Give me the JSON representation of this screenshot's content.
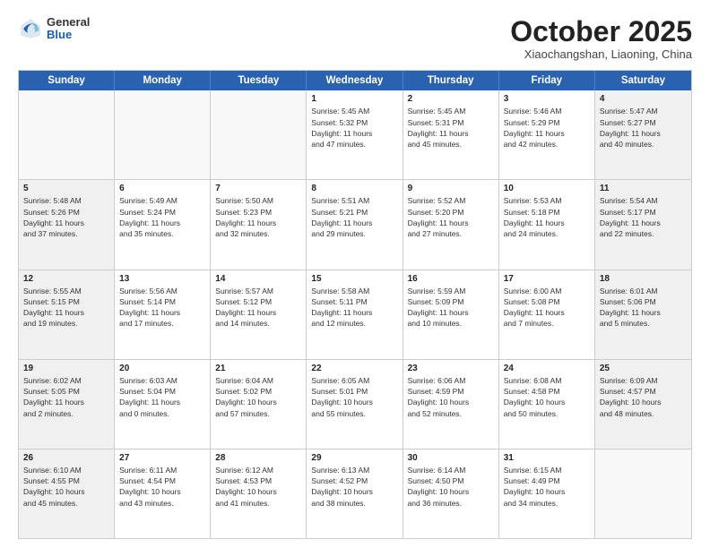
{
  "logo": {
    "general": "General",
    "blue": "Blue"
  },
  "header": {
    "month": "October 2025",
    "location": "Xiaochangshan, Liaoning, China"
  },
  "days": [
    "Sunday",
    "Monday",
    "Tuesday",
    "Wednesday",
    "Thursday",
    "Friday",
    "Saturday"
  ],
  "rows": [
    [
      {
        "day": "",
        "text": ""
      },
      {
        "day": "",
        "text": ""
      },
      {
        "day": "",
        "text": ""
      },
      {
        "day": "1",
        "text": "Sunrise: 5:45 AM\nSunset: 5:32 PM\nDaylight: 11 hours\nand 47 minutes."
      },
      {
        "day": "2",
        "text": "Sunrise: 5:45 AM\nSunset: 5:31 PM\nDaylight: 11 hours\nand 45 minutes."
      },
      {
        "day": "3",
        "text": "Sunrise: 5:46 AM\nSunset: 5:29 PM\nDaylight: 11 hours\nand 42 minutes."
      },
      {
        "day": "4",
        "text": "Sunrise: 5:47 AM\nSunset: 5:27 PM\nDaylight: 11 hours\nand 40 minutes."
      }
    ],
    [
      {
        "day": "5",
        "text": "Sunrise: 5:48 AM\nSunset: 5:26 PM\nDaylight: 11 hours\nand 37 minutes."
      },
      {
        "day": "6",
        "text": "Sunrise: 5:49 AM\nSunset: 5:24 PM\nDaylight: 11 hours\nand 35 minutes."
      },
      {
        "day": "7",
        "text": "Sunrise: 5:50 AM\nSunset: 5:23 PM\nDaylight: 11 hours\nand 32 minutes."
      },
      {
        "day": "8",
        "text": "Sunrise: 5:51 AM\nSunset: 5:21 PM\nDaylight: 11 hours\nand 29 minutes."
      },
      {
        "day": "9",
        "text": "Sunrise: 5:52 AM\nSunset: 5:20 PM\nDaylight: 11 hours\nand 27 minutes."
      },
      {
        "day": "10",
        "text": "Sunrise: 5:53 AM\nSunset: 5:18 PM\nDaylight: 11 hours\nand 24 minutes."
      },
      {
        "day": "11",
        "text": "Sunrise: 5:54 AM\nSunset: 5:17 PM\nDaylight: 11 hours\nand 22 minutes."
      }
    ],
    [
      {
        "day": "12",
        "text": "Sunrise: 5:55 AM\nSunset: 5:15 PM\nDaylight: 11 hours\nand 19 minutes."
      },
      {
        "day": "13",
        "text": "Sunrise: 5:56 AM\nSunset: 5:14 PM\nDaylight: 11 hours\nand 17 minutes."
      },
      {
        "day": "14",
        "text": "Sunrise: 5:57 AM\nSunset: 5:12 PM\nDaylight: 11 hours\nand 14 minutes."
      },
      {
        "day": "15",
        "text": "Sunrise: 5:58 AM\nSunset: 5:11 PM\nDaylight: 11 hours\nand 12 minutes."
      },
      {
        "day": "16",
        "text": "Sunrise: 5:59 AM\nSunset: 5:09 PM\nDaylight: 11 hours\nand 10 minutes."
      },
      {
        "day": "17",
        "text": "Sunrise: 6:00 AM\nSunset: 5:08 PM\nDaylight: 11 hours\nand 7 minutes."
      },
      {
        "day": "18",
        "text": "Sunrise: 6:01 AM\nSunset: 5:06 PM\nDaylight: 11 hours\nand 5 minutes."
      }
    ],
    [
      {
        "day": "19",
        "text": "Sunrise: 6:02 AM\nSunset: 5:05 PM\nDaylight: 11 hours\nand 2 minutes."
      },
      {
        "day": "20",
        "text": "Sunrise: 6:03 AM\nSunset: 5:04 PM\nDaylight: 11 hours\nand 0 minutes."
      },
      {
        "day": "21",
        "text": "Sunrise: 6:04 AM\nSunset: 5:02 PM\nDaylight: 10 hours\nand 57 minutes."
      },
      {
        "day": "22",
        "text": "Sunrise: 6:05 AM\nSunset: 5:01 PM\nDaylight: 10 hours\nand 55 minutes."
      },
      {
        "day": "23",
        "text": "Sunrise: 6:06 AM\nSunset: 4:59 PM\nDaylight: 10 hours\nand 52 minutes."
      },
      {
        "day": "24",
        "text": "Sunrise: 6:08 AM\nSunset: 4:58 PM\nDaylight: 10 hours\nand 50 minutes."
      },
      {
        "day": "25",
        "text": "Sunrise: 6:09 AM\nSunset: 4:57 PM\nDaylight: 10 hours\nand 48 minutes."
      }
    ],
    [
      {
        "day": "26",
        "text": "Sunrise: 6:10 AM\nSunset: 4:55 PM\nDaylight: 10 hours\nand 45 minutes."
      },
      {
        "day": "27",
        "text": "Sunrise: 6:11 AM\nSunset: 4:54 PM\nDaylight: 10 hours\nand 43 minutes."
      },
      {
        "day": "28",
        "text": "Sunrise: 6:12 AM\nSunset: 4:53 PM\nDaylight: 10 hours\nand 41 minutes."
      },
      {
        "day": "29",
        "text": "Sunrise: 6:13 AM\nSunset: 4:52 PM\nDaylight: 10 hours\nand 38 minutes."
      },
      {
        "day": "30",
        "text": "Sunrise: 6:14 AM\nSunset: 4:50 PM\nDaylight: 10 hours\nand 36 minutes."
      },
      {
        "day": "31",
        "text": "Sunrise: 6:15 AM\nSunset: 4:49 PM\nDaylight: 10 hours\nand 34 minutes."
      },
      {
        "day": "",
        "text": ""
      }
    ]
  ]
}
